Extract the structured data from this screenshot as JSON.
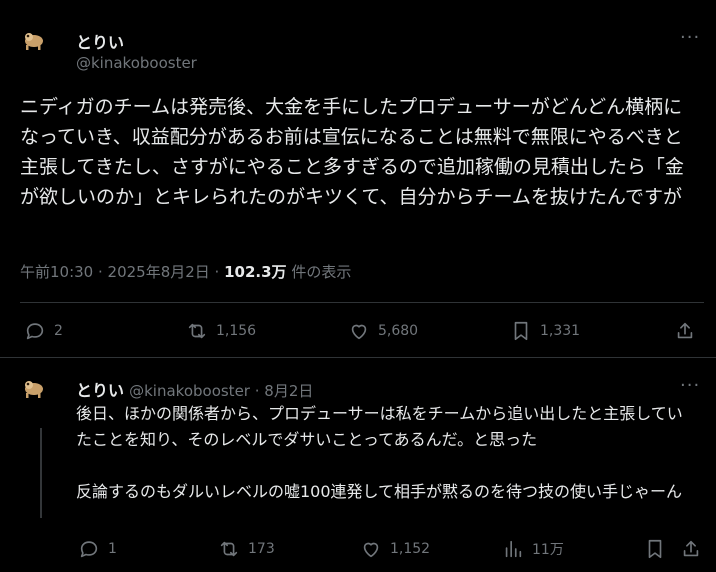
{
  "tweet": {
    "name": "とりい",
    "handle": "@kinakobooster",
    "more": "···",
    "text": "ニディガのチームは発売後、大金を手にしたプロデューサーがどんどん横柄になっていき、収益配分があるお前は宣伝になることは無料で無限にやるべきと主張してきたし、さすがにやること多すぎるので追加稼働の見積出したら「金が欲しいのか」とキレられたのがキツくて、自分からチームを抜けたんですが",
    "time": "午前10:30 · 2025年8月2日 · ",
    "views_count": "102.3万",
    "views_label": " 件の表示",
    "actions": {
      "replies": "2",
      "retweets": "1,156",
      "likes": "5,680",
      "bookmarks": "1,331"
    }
  },
  "reply": {
    "name": "とりい",
    "handle": "@kinakobooster",
    "date": " · 8月2日",
    "more": "···",
    "text": "後日、ほかの関係者から、プロデューサーは私をチームから追い出したと主張していたことを知り、そのレベルでダサいことってあるんだ。と思った\n\n反論するのもダルいレベルの嘘100連発して相手が黙るのを待つ技の使い手じゃーん",
    "actions": {
      "replies": "1",
      "retweets": "173",
      "likes": "1,152",
      "views": "11万"
    }
  },
  "colors": {
    "background": "#000000",
    "text": "#e7e9ea",
    "muted": "#71767b",
    "divider": "#2f3336"
  }
}
